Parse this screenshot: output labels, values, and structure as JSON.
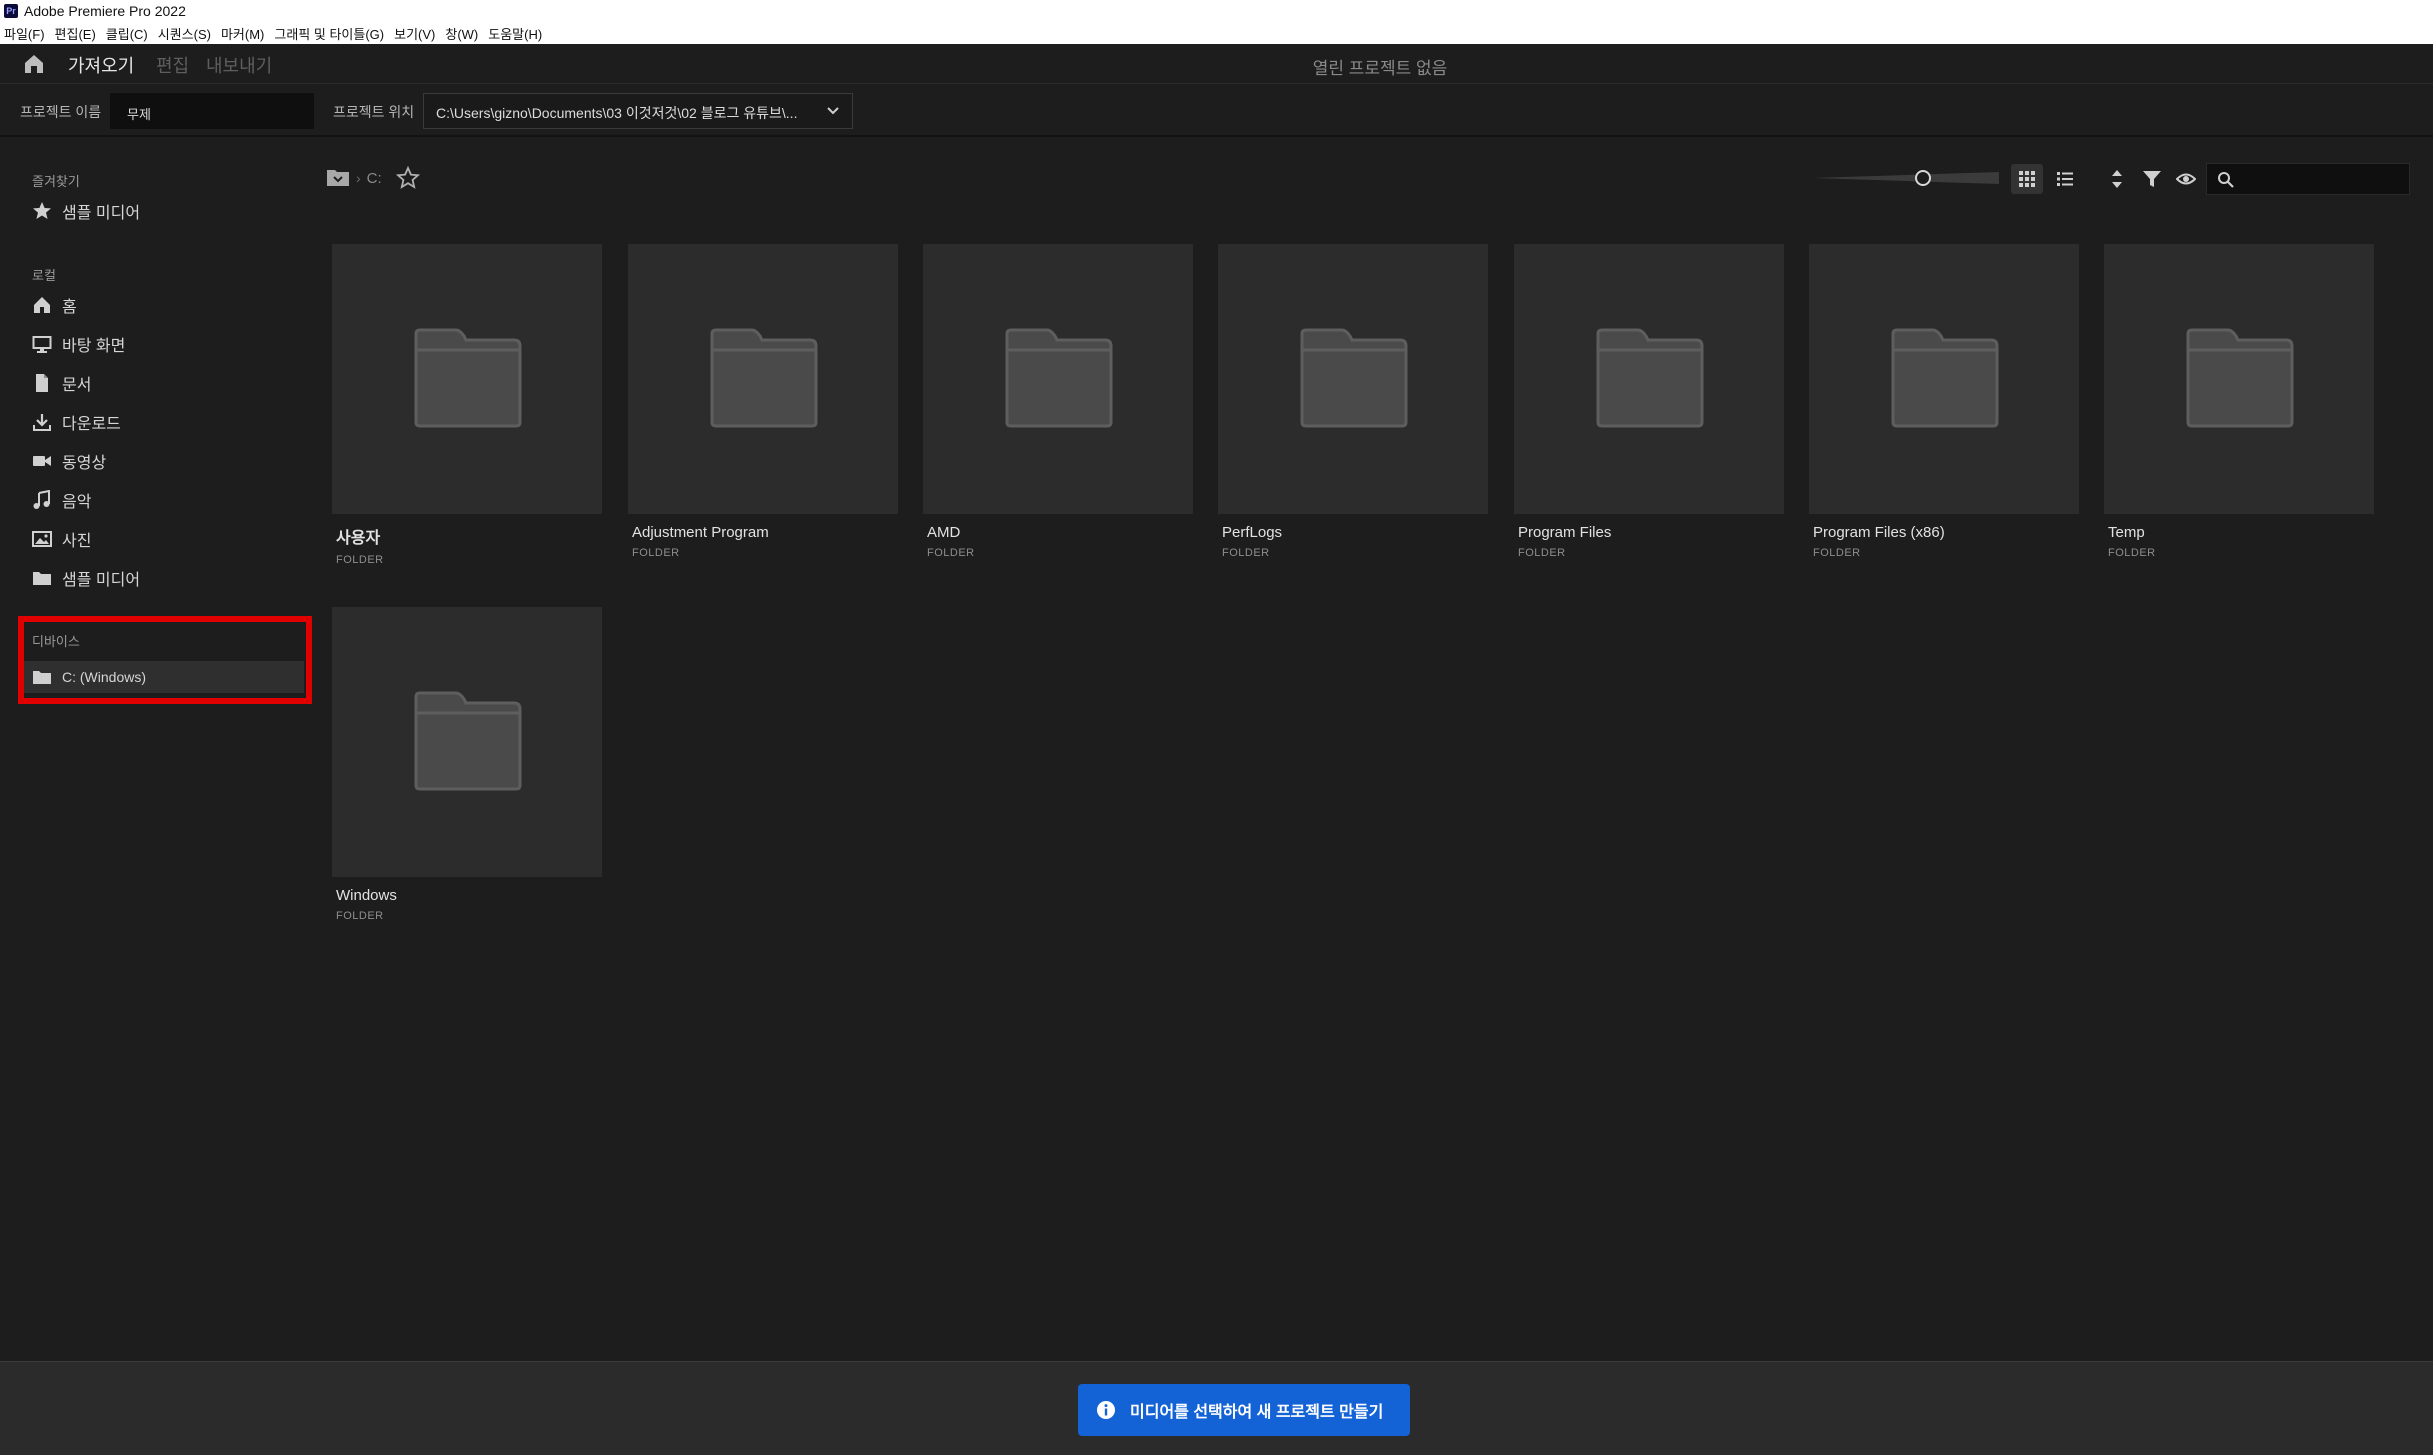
{
  "window": {
    "logo_text": "Pr",
    "title": "Adobe Premiere Pro 2022"
  },
  "menu": [
    "파일(F)",
    "편집(E)",
    "클립(C)",
    "시퀀스(S)",
    "마커(M)",
    "그래픽 및 타이틀(G)",
    "보기(V)",
    "창(W)",
    "도움말(H)"
  ],
  "workspace": {
    "tabs": [
      "가져오기",
      "편집",
      "내보내기"
    ],
    "active_tab": "가져오기",
    "status": "열린 프로젝트 없음"
  },
  "project": {
    "name_label": "프로젝트 이름",
    "name_value": "무제",
    "location_label": "프로젝트 위치",
    "location_value": "C:\\Users\\gizno\\Documents\\03 이것저것\\02 블로그 유튜브\\..."
  },
  "sidebar": {
    "favorites_heading": "즐겨찾기",
    "favorites": [
      {
        "label": "샘플 미디어",
        "icon": "star-icon"
      }
    ],
    "local_heading": "로컬",
    "local": [
      {
        "label": "홈",
        "icon": "home-icon"
      },
      {
        "label": "바탕 화면",
        "icon": "desktop-icon"
      },
      {
        "label": "문서",
        "icon": "document-icon"
      },
      {
        "label": "다운로드",
        "icon": "download-icon"
      },
      {
        "label": "동영상",
        "icon": "video-icon"
      },
      {
        "label": "음악",
        "icon": "music-icon"
      },
      {
        "label": "사진",
        "icon": "photo-icon"
      },
      {
        "label": "샘플 미디어",
        "icon": "folder-icon"
      }
    ],
    "devices_heading": "디바이스",
    "devices": [
      {
        "label": "C: (Windows)",
        "icon": "folder-icon",
        "selected": true
      }
    ]
  },
  "browser": {
    "breadcrumb": "C:",
    "zoom_level": 0.6,
    "view_mode": "grid",
    "search_placeholder": "",
    "items": [
      {
        "name": "사용자",
        "kind": "FOLDER"
      },
      {
        "name": "Adjustment Program",
        "kind": "FOLDER"
      },
      {
        "name": "AMD",
        "kind": "FOLDER"
      },
      {
        "name": "PerfLogs",
        "kind": "FOLDER"
      },
      {
        "name": "Program Files",
        "kind": "FOLDER"
      },
      {
        "name": "Program Files (x86)",
        "kind": "FOLDER"
      },
      {
        "name": "Temp",
        "kind": "FOLDER"
      },
      {
        "name": "Windows",
        "kind": "FOLDER"
      }
    ]
  },
  "footer": {
    "create_label": "미디어를 선택하여 새 프로젝트 만들기"
  },
  "colors": {
    "accent": "#1463d6",
    "highlight": "#e00000",
    "background": "#1d1d1d",
    "tile": "#2c2c2c"
  }
}
